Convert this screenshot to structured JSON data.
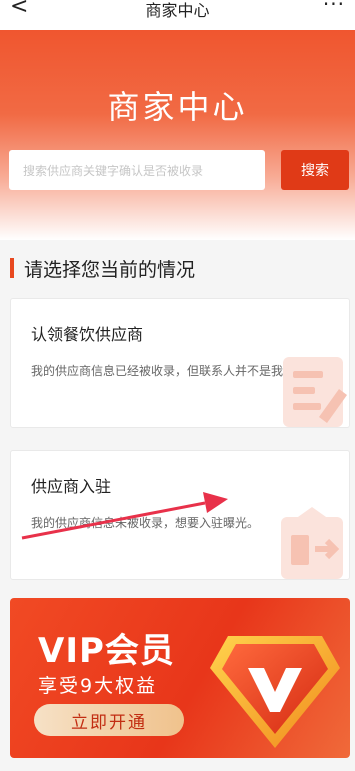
{
  "header": {
    "title": "商家中心",
    "back_icon": "chevron-left-icon",
    "more_icon": "more-dots-icon",
    "back_glyph": "<",
    "more_glyph": "···"
  },
  "hero": {
    "title": "商家中心"
  },
  "search": {
    "placeholder": "搜索供应商关键字确认是否被收录",
    "button_label": "搜索"
  },
  "section": {
    "title": "请选择您当前的情况"
  },
  "cards": [
    {
      "title": "认领餐饮供应商",
      "desc": "我的供应商信息已经被收录，但联系人并不是我。",
      "icon": "document-edit-icon"
    },
    {
      "title": "供应商入驻",
      "desc": "我的供应商信息未被收录，想要入驻曝光。",
      "icon": "store-enter-icon"
    }
  ],
  "vip": {
    "title": "VIP会员",
    "subtitle": "享受9大权益",
    "button_label": "立即开通",
    "emblem_letter": "V"
  },
  "colors": {
    "accent": "#e8481f",
    "button_red": "#e03a17",
    "annotation_arrow": "#e8314a"
  }
}
